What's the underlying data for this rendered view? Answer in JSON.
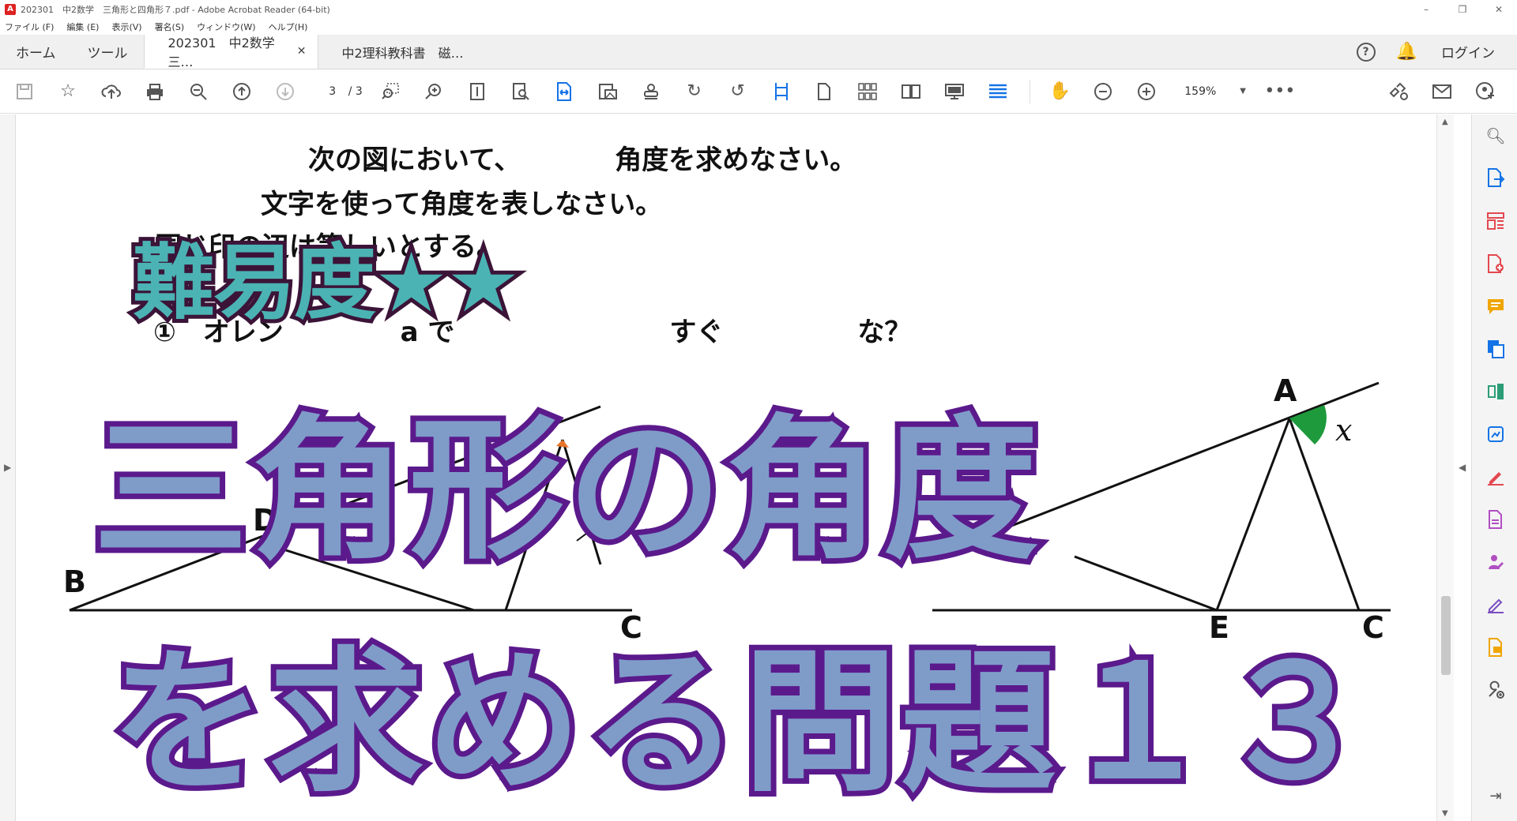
{
  "window": {
    "title": "202301　中2数学　三角形と四角形７.pdf - Adobe Acrobat Reader (64-bit)",
    "controls": [
      "–",
      "❐",
      "✕"
    ]
  },
  "menu": [
    "ファイル (F)",
    "編集 (E)",
    "表示(V)",
    "署名(S)",
    "ウィンドウ(W)",
    "ヘルプ(H)"
  ],
  "tabs": {
    "home": "ホーム",
    "tools": "ツール",
    "doc1": "202301　中2数学　三…",
    "doc1_close": "✕",
    "doc2": "中2理科教科書　磁…",
    "help": "?",
    "login": "ログイン"
  },
  "toolbar": {
    "page_current": "3",
    "page_total": "/ 3",
    "zoom": "159%"
  },
  "document": {
    "line1": "次の図において、　　　　角度を求めなさい。",
    "line2": "文字を使って角度を表しなさい。",
    "line3": "同じ印の辺は等しいとする。",
    "question": "①　オレン　　　　 a で　　　　　　　　すぐ　　　　　な？",
    "labels": {
      "A": "A",
      "B": "B",
      "C": "C",
      "D": "D",
      "D2": "D",
      "E": "E",
      "C2": "C",
      "x": "𝑥"
    }
  },
  "overlay": {
    "difficulty": "難易度★★",
    "headline1": "三角形の角度",
    "headline2": "を求める問題１３"
  },
  "colors": {
    "acrobat_blue": "#1473e6",
    "difficulty_fill": "#4bb3b3",
    "difficulty_stroke": "#3b1438",
    "headline_fill": "#7f9cc9",
    "headline_stroke": "#5b1a8c",
    "angle_mark": "#1e9a3c"
  }
}
